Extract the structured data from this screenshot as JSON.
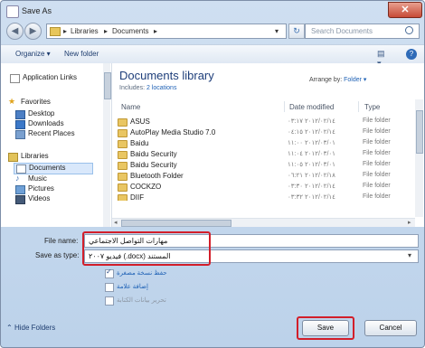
{
  "window": {
    "title": "Save As",
    "close_glyph": "✕"
  },
  "nav": {
    "back_glyph": "◀",
    "forward_glyph": "▶",
    "breadcrumb": [
      "Libraries",
      "Documents"
    ],
    "breadcrumb_sep": "▸",
    "dropdown_glyph": "▾",
    "refresh_glyph": "↻",
    "search_placeholder": "Search Documents"
  },
  "toolbar": {
    "organize": "Organize ▾",
    "new_folder": "New folder",
    "views_glyph": "▤ ▾",
    "help_glyph": "?"
  },
  "sidebar": {
    "items": [
      {
        "label": "Application Links",
        "icon": "page-icon"
      },
      {
        "label": "Favorites",
        "icon": "star-icon"
      },
      {
        "label": "Desktop",
        "icon": "desktop-icon"
      },
      {
        "label": "Downloads",
        "icon": "downloads-icon"
      },
      {
        "label": "Recent Places",
        "icon": "recent-places-icon"
      },
      {
        "label": "Libraries",
        "icon": "libraries-icon"
      },
      {
        "label": "Documents",
        "icon": "documents-icon"
      },
      {
        "label": "Music",
        "icon": "music-icon"
      },
      {
        "label": "Pictures",
        "icon": "pictures-icon"
      },
      {
        "label": "Videos",
        "icon": "videos-icon"
      }
    ]
  },
  "library": {
    "title": "Documents library",
    "subtitle_prefix": "Includes:",
    "subtitle_link": "2 locations",
    "arrange_label": "Arrange by:",
    "arrange_value": "Folder ▾"
  },
  "columns": {
    "name": "Name",
    "date": "Date modified",
    "type": "Type"
  },
  "files": [
    {
      "name": "ASUS",
      "date": "٢٠١٢/٠٢/١٤ ٠٣:١٧",
      "type": "File folder"
    },
    {
      "name": "AutoPlay Media Studio 7.0",
      "date": "٢٠١٢/٠٢/١٤ ٠٤:١٥",
      "type": "File folder"
    },
    {
      "name": "Baidu",
      "date": "٢٠١٢/٠٣/٠١ ١١:٠٠",
      "type": "File folder"
    },
    {
      "name": "Baidu Security",
      "date": "٢٠١٢/٠٣/٠١ ١١:٠٤",
      "type": "File folder"
    },
    {
      "name": "Baidu Security",
      "date": "٢٠١٢/٠٣/٠١ ١١:٠٥",
      "type": "File folder"
    },
    {
      "name": "Bluetooth Folder",
      "date": "٢٠١٢/٠٢/١٨ ٠٦:٢١",
      "type": "File folder"
    },
    {
      "name": "COCKZO",
      "date": "٢٠١٢/٠٢/١٤ ٠٣:٣٠",
      "type": "File folder"
    },
    {
      "name": "DIIF",
      "date": "٢٠١٢/٠٢/١٤ ٠٣:٣٢",
      "type": "File folder"
    }
  ],
  "form": {
    "file_name_label": "File name:",
    "file_name_value": "مهارات التواصل الاجتماعي",
    "save_type_label": "Save as type:",
    "save_type_value": "فيديو ٢٠٠٧ (.docx) المستند",
    "options": [
      {
        "label": "حفظ نسخة مصغرة",
        "checked": true
      },
      {
        "label": "إضافة علامة",
        "checked": false
      },
      {
        "label": "تحرير بيانات الكتابة",
        "checked": false
      }
    ],
    "hide_folders": "Hide Folders",
    "save_button": "Save",
    "cancel_button": "Cancel"
  }
}
